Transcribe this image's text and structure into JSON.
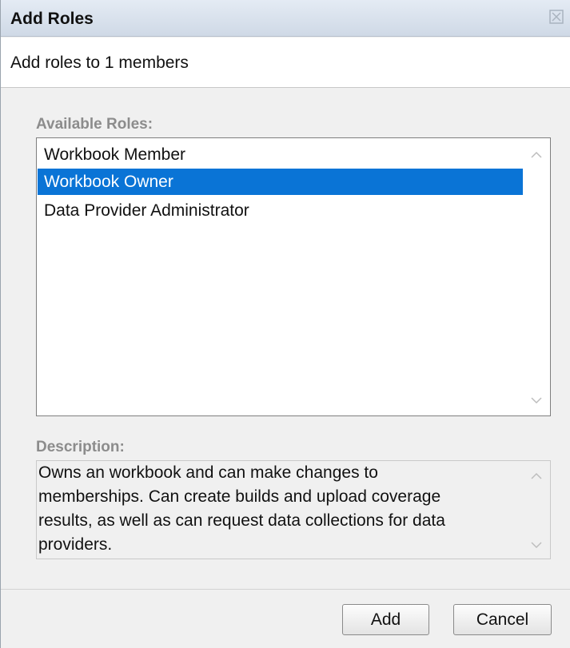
{
  "dialog": {
    "title": "Add Roles",
    "subtitle": "Add roles to 1 members",
    "close_icon": "close-x-icon"
  },
  "roles": {
    "label": "Available Roles:",
    "items": [
      {
        "label": "Workbook Member",
        "selected": false
      },
      {
        "label": "Workbook Owner",
        "selected": true
      },
      {
        "label": "Data Provider Administrator",
        "selected": false
      }
    ]
  },
  "description": {
    "label": "Description:",
    "lines": [
      "Owns an workbook and can make changes to",
      "memberships. Can create builds and upload coverage",
      "results, as well as can request data collections for data",
      "providers."
    ]
  },
  "buttons": {
    "add": "Add",
    "cancel": "Cancel"
  },
  "colors": {
    "selection": "#0a74d6",
    "title_bar": "#d7e0eb"
  }
}
